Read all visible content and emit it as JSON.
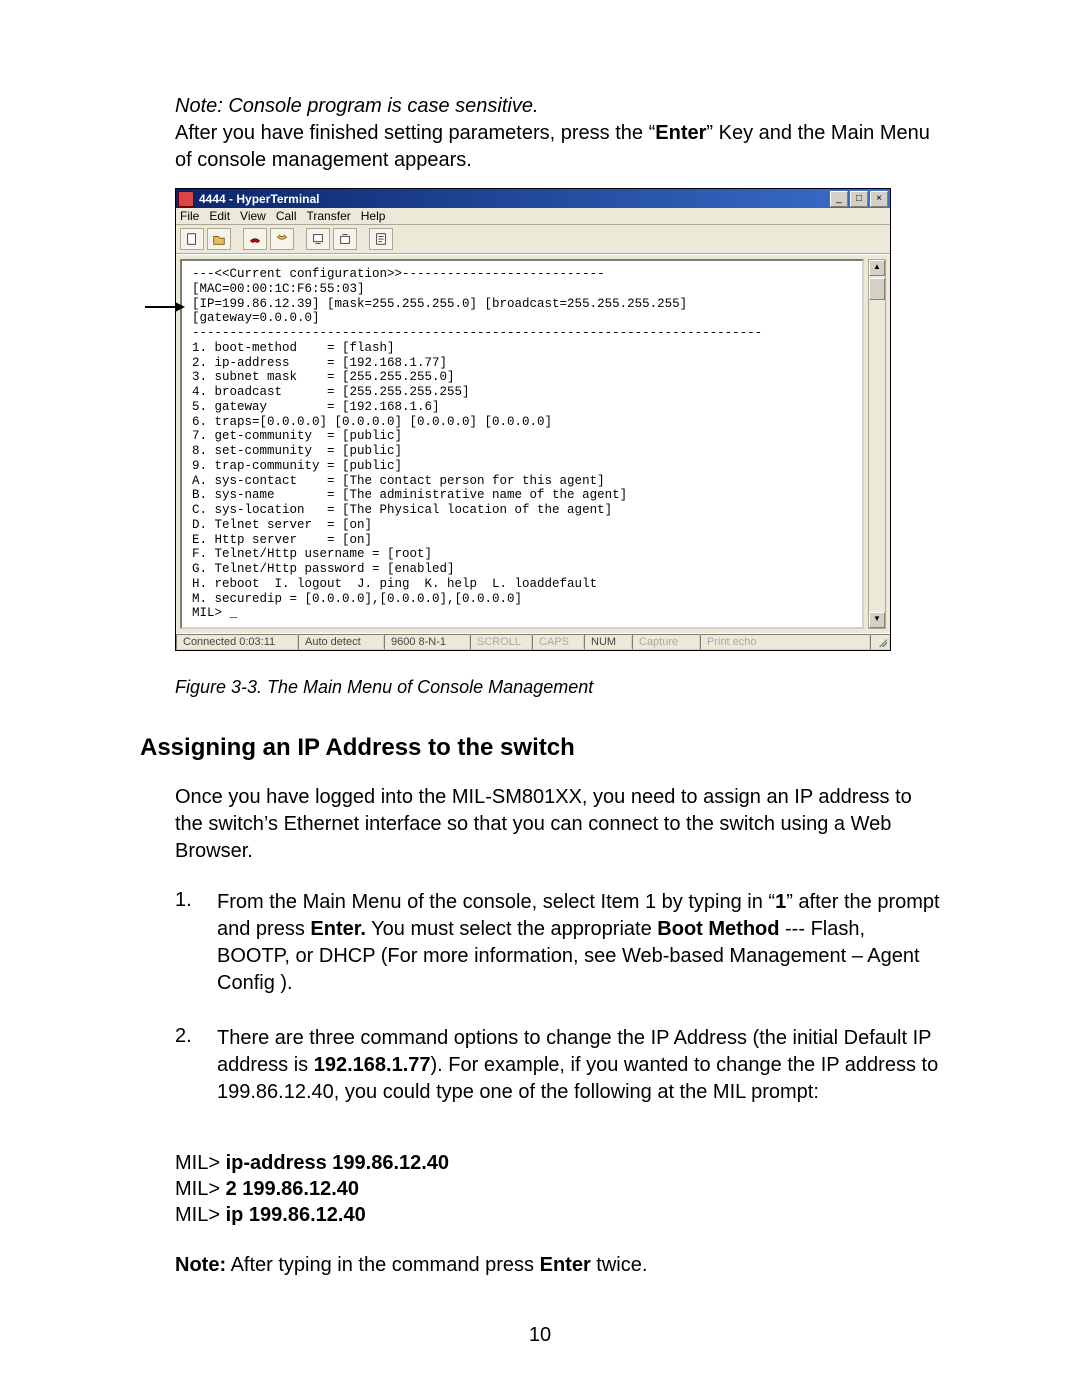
{
  "intro": {
    "note_line": "Note: Console program is case sensitive.",
    "para_before": "After you have finished setting parameters, press the ",
    "quote_open": "“",
    "enter_word": "Enter",
    "quote_close": "”",
    "para_after": " Key and the Main Menu of console management appears."
  },
  "hyperterm": {
    "window_title": "4444 - HyperTerminal",
    "menus": [
      "File",
      "Edit",
      "View",
      "Call",
      "Transfer",
      "Help"
    ],
    "toolbar_icons": [
      "new-file-icon",
      "open-file-icon",
      "hangup-icon",
      "dial-icon",
      "send-icon",
      "receive-icon",
      "properties-icon"
    ],
    "terminal_text": "---<<Current configuration>>---------------------------\n[MAC=00:00:1C:F6:55:03]\n[IP=199.86.12.39] [mask=255.255.255.0] [broadcast=255.255.255.255]\n[gateway=0.0.0.0]\n----------------------------------------------------------------------------\n1. boot-method    = [flash]\n2. ip-address     = [192.168.1.77]\n3. subnet mask    = [255.255.255.0]\n4. broadcast      = [255.255.255.255]\n5. gateway        = [192.168.1.6]\n6. traps=[0.0.0.0] [0.0.0.0] [0.0.0.0] [0.0.0.0]\n7. get-community  = [public]\n8. set-community  = [public]\n9. trap-community = [public]\nA. sys-contact    = [The contact person for this agent]\nB. sys-name       = [The administrative name of the agent]\nC. sys-location   = [The Physical location of the agent]\nD. Telnet server  = [on]\nE. Http server    = [on]\nF. Telnet/Http username = [root]\nG. Telnet/Http password = [enabled]\nH. reboot  I. logout  J. ping  K. help  L. loaddefault\nM. securedip = [0.0.0.0],[0.0.0.0],[0.0.0.0]\nMIL> _",
    "status_cells": [
      "Connected 0:03:11",
      "Auto detect",
      "9600 8-N-1",
      "SCROLL",
      "CAPS",
      "NUM",
      "Capture",
      "Print echo"
    ]
  },
  "figure_caption": "Figure 3-3. The Main Menu of Console Management",
  "section_heading": "Assigning an IP Address to the switch",
  "section_intro": "Once you have logged into the MIL-SM801XX, you need to assign an IP address to the switch’s Ethernet interface so that you can connect to the switch using a Web Browser.",
  "steps": [
    {
      "num": "1.",
      "pre": "From the Main Menu of the console, select Item 1 by typing in ",
      "q1o": "“",
      "one": "1",
      "q1c": "”",
      "mid1": " after the prompt and  press ",
      "enter": "Enter.",
      "mid2": "  You must select the appropriate ",
      "bootm": "Boot Method",
      "tail": " --- Flash, BOOTP, or DHCP (For more information, see Web-based Management – Agent Config )."
    },
    {
      "num": "2.",
      "pre": "There are three command options to change the IP Address (the initial Default IP address is ",
      "ip": "192.168.1.77",
      "tail": ").  For example, if you wanted to change the IP address to 199.86.12.40, you could type one of the following at the MIL prompt:"
    }
  ],
  "commands": {
    "p1": "MIL> ",
    "c1": "ip-address 199.86.12.40",
    "p2": "MIL> ",
    "c2": "2 199.86.12.40",
    "p3": "MIL> ",
    "c3": "ip 199.86.12.40"
  },
  "note2": {
    "label": "Note:",
    "pre": "  After typing in the command press ",
    "enter": "Enter",
    "post": " twice."
  },
  "page_number": "10"
}
